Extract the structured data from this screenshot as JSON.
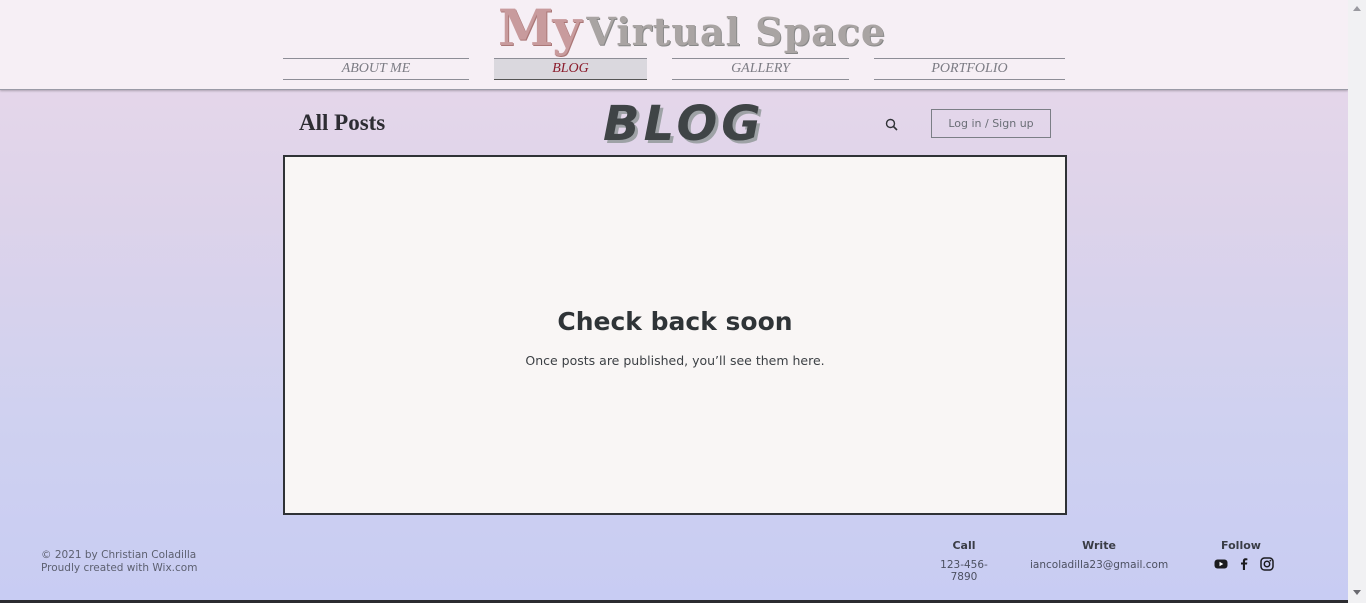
{
  "site": {
    "title_my": "My",
    "title_rest": "Virtual Space"
  },
  "nav": {
    "items": [
      {
        "label": "ABOUT ME"
      },
      {
        "label": "BLOG"
      },
      {
        "label": "GALLERY"
      },
      {
        "label": "PORTFOLIO"
      }
    ],
    "active": "BLOG"
  },
  "blog": {
    "all_posts_label": "All Posts",
    "logo_text": "BLOG",
    "login_label": "Log in / Sign up",
    "empty_title": "Check back soon",
    "empty_subtitle": "Once posts are published, you’ll see them here."
  },
  "footer": {
    "copyright": "© 2021 by Christian Coladilla",
    "credit": "Proudly created with Wix.com",
    "call": {
      "heading": "Call",
      "value": "123-456-7890"
    },
    "write": {
      "heading": "Write",
      "value": "iancoladilla23@gmail.com"
    },
    "follow": {
      "heading": "Follow",
      "icons": [
        "youtube-icon",
        "facebook-icon",
        "instagram-icon"
      ]
    }
  },
  "colors": {
    "accent_active_nav": "#8b1c2c",
    "title_my": "#c89b9d",
    "title_rest": "#a9a4a3",
    "text_dark": "#2f3437"
  }
}
